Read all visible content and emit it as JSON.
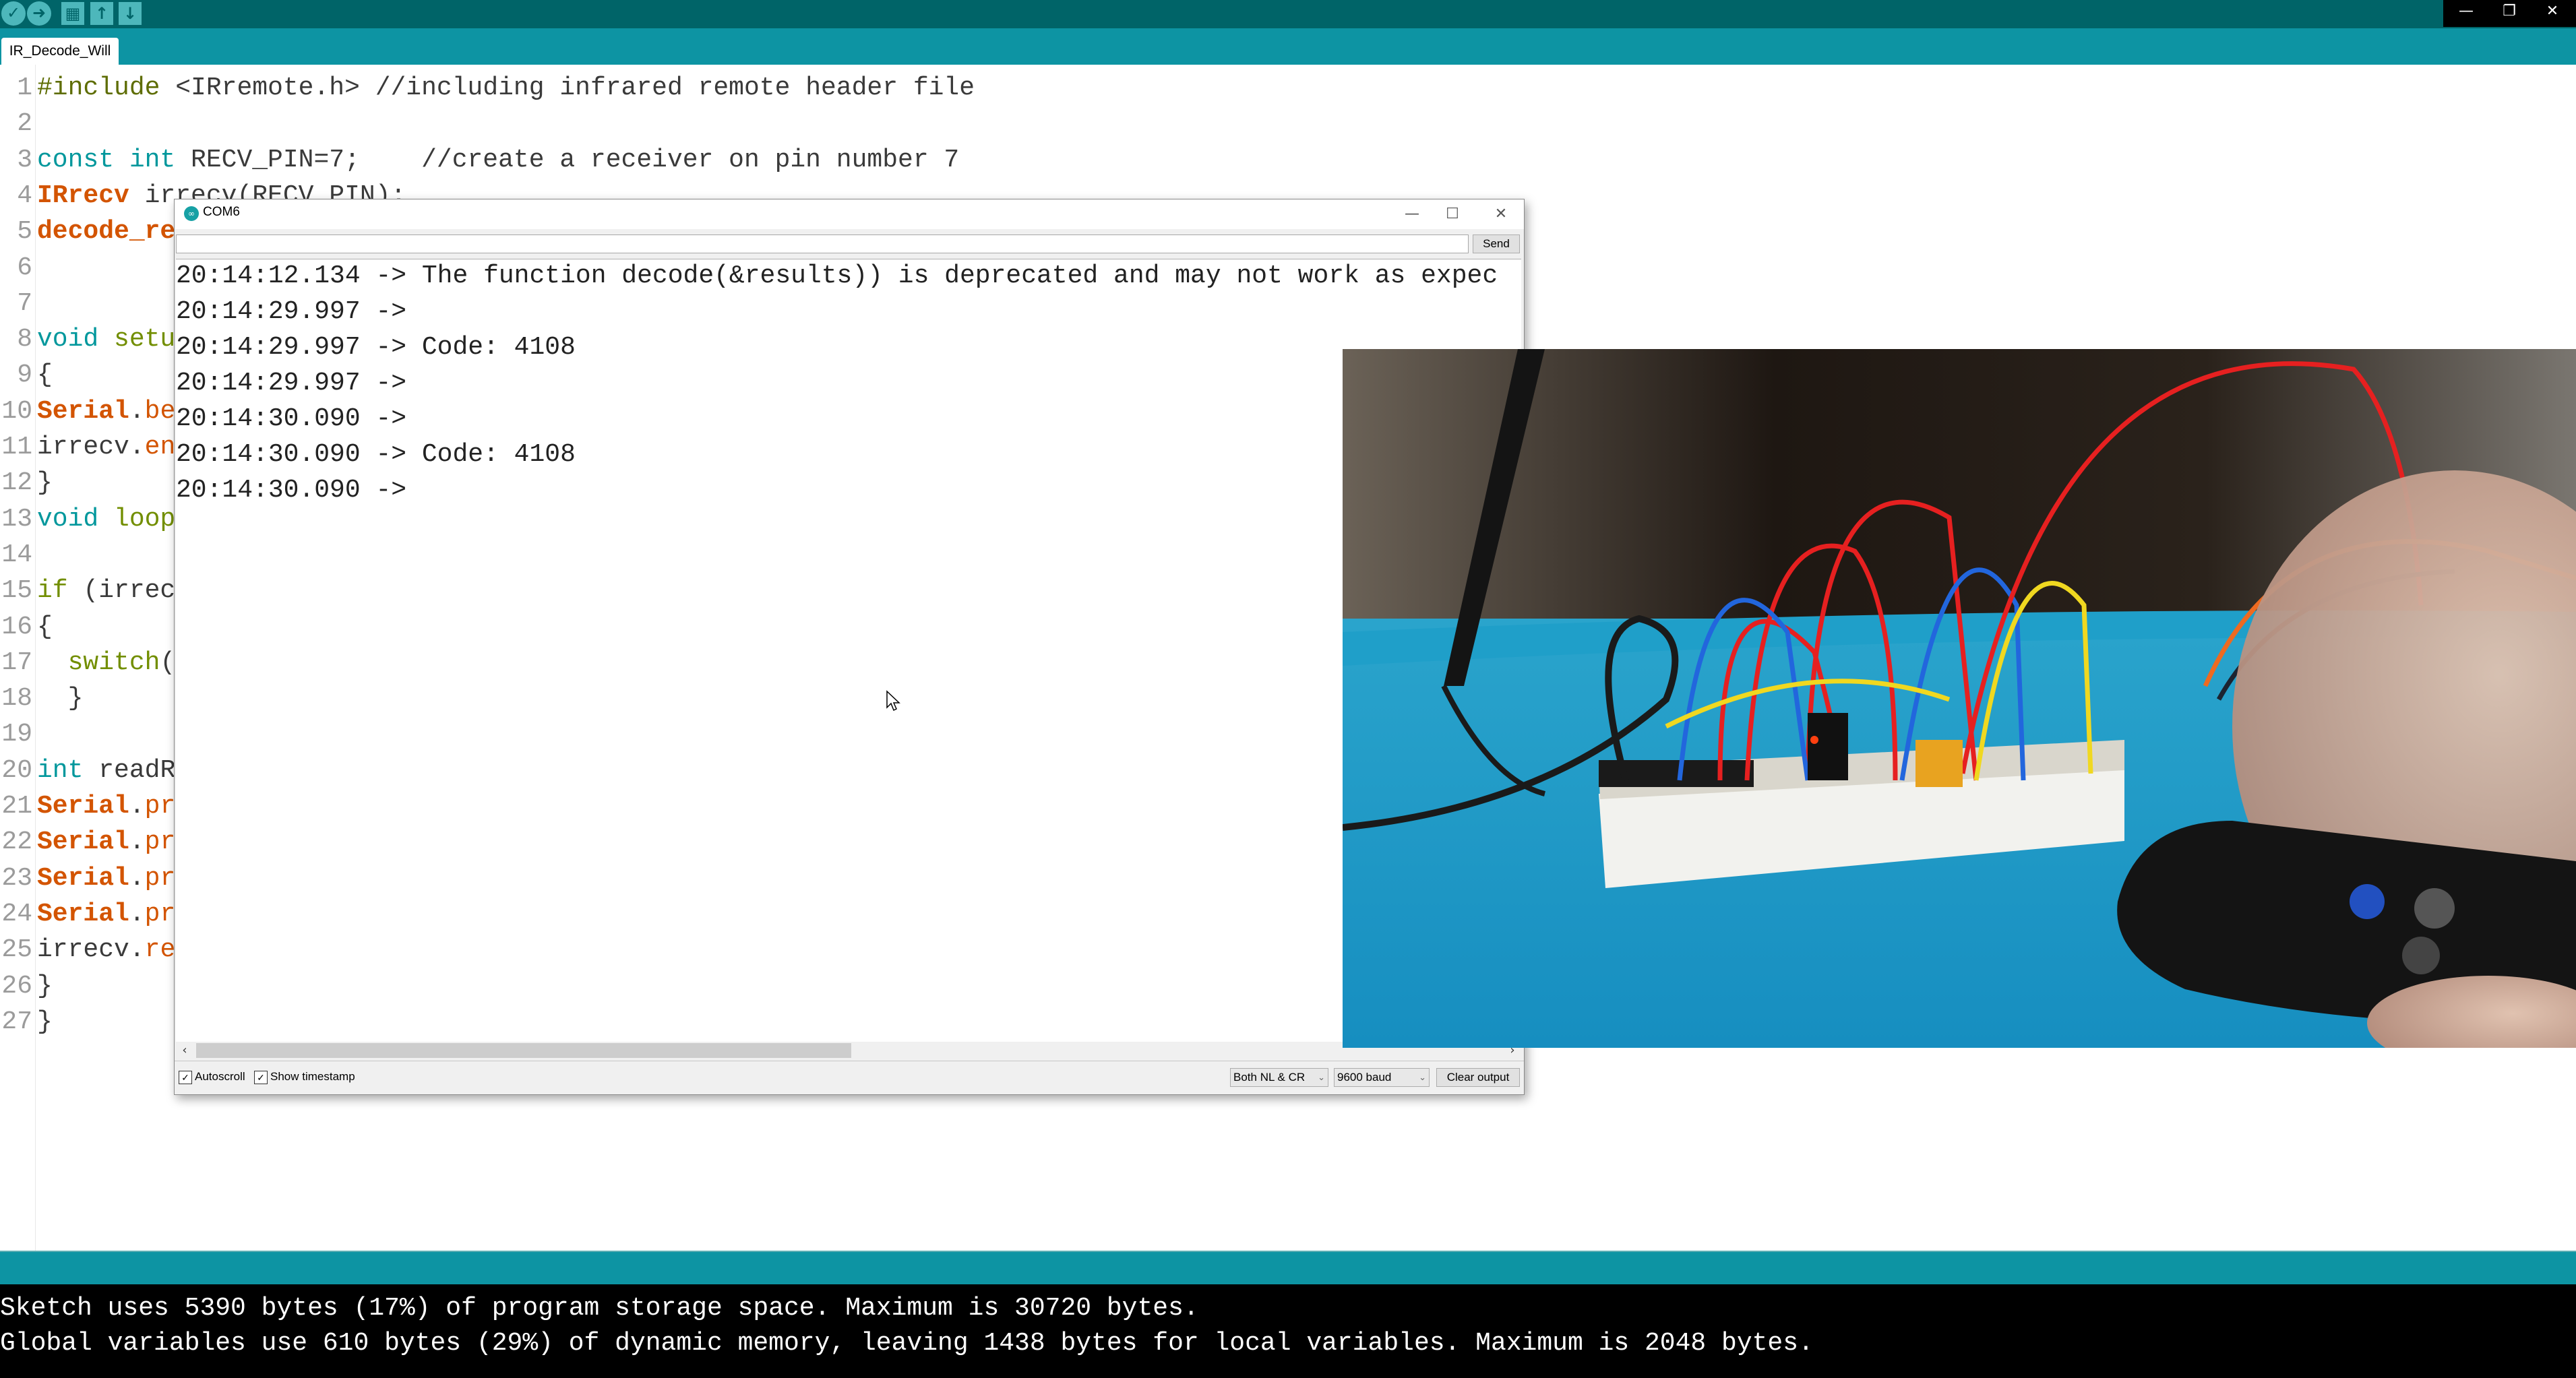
{
  "toolbar": {
    "buttons": [
      {
        "name": "verify",
        "icon": "check-icon",
        "glyph": "✓"
      },
      {
        "name": "upload",
        "icon": "arrow-right-icon",
        "glyph": "➜"
      },
      {
        "name": "new",
        "icon": "new-file-icon",
        "glyph": "▦"
      },
      {
        "name": "open",
        "icon": "arrow-up-icon",
        "glyph": "↑"
      },
      {
        "name": "save",
        "icon": "arrow-down-icon",
        "glyph": "↓"
      }
    ],
    "window_controls": {
      "minimize": "—",
      "restore": "❐",
      "close": "✕"
    }
  },
  "tabs": [
    {
      "label": "IR_Decode_Will",
      "active": true
    }
  ],
  "editor": {
    "lines": [
      {
        "n": "1",
        "segments": [
          {
            "t": "#include",
            "c": "pp"
          },
          {
            "t": " <IRremote.h> //including infrared remote header file",
            "c": ""
          }
        ]
      },
      {
        "n": "2",
        "segments": []
      },
      {
        "n": "3",
        "segments": [
          {
            "t": "const int",
            "c": "kw"
          },
          {
            "t": " RECV_PIN=7;    //create a receiver on pin number 7",
            "c": ""
          }
        ]
      },
      {
        "n": "4",
        "segments": [
          {
            "t": "IRrecv",
            "c": "ty"
          },
          {
            "t": " irrecv(RECV_PIN);",
            "c": ""
          }
        ]
      },
      {
        "n": "5",
        "segments": [
          {
            "t": "decode_re",
            "c": "ty"
          }
        ]
      },
      {
        "n": "6",
        "segments": []
      },
      {
        "n": "7",
        "segments": []
      },
      {
        "n": "8",
        "segments": [
          {
            "t": "void",
            "c": "kw"
          },
          {
            "t": " setu",
            "c": "ctl"
          }
        ]
      },
      {
        "n": "9",
        "segments": [
          {
            "t": "{",
            "c": ""
          }
        ]
      },
      {
        "n": "10",
        "segments": [
          {
            "t": "Serial",
            "c": "ty"
          },
          {
            "t": ".",
            "c": ""
          },
          {
            "t": "be",
            "c": "fn"
          }
        ]
      },
      {
        "n": "11",
        "segments": [
          {
            "t": "irrecv.",
            "c": ""
          },
          {
            "t": "en",
            "c": "fn"
          }
        ]
      },
      {
        "n": "12",
        "segments": [
          {
            "t": "}",
            "c": ""
          }
        ]
      },
      {
        "n": "13",
        "segments": [
          {
            "t": "void",
            "c": "kw"
          },
          {
            "t": " loop",
            "c": "ctl"
          }
        ]
      },
      {
        "n": "14",
        "segments": []
      },
      {
        "n": "15",
        "segments": [
          {
            "t": "if",
            "c": "ctl"
          },
          {
            "t": " (irrec",
            "c": ""
          }
        ]
      },
      {
        "n": "16",
        "segments": [
          {
            "t": "{",
            "c": ""
          }
        ]
      },
      {
        "n": "17",
        "segments": [
          {
            "t": "  switch",
            "c": "ctl"
          },
          {
            "t": "(",
            "c": ""
          }
        ]
      },
      {
        "n": "18",
        "segments": [
          {
            "t": "  }",
            "c": ""
          }
        ]
      },
      {
        "n": "19",
        "segments": []
      },
      {
        "n": "20",
        "segments": [
          {
            "t": "int",
            "c": "kw"
          },
          {
            "t": " readR",
            "c": ""
          }
        ]
      },
      {
        "n": "21",
        "segments": [
          {
            "t": "Serial",
            "c": "ty"
          },
          {
            "t": ".",
            "c": ""
          },
          {
            "t": "pr",
            "c": "fn"
          }
        ]
      },
      {
        "n": "22",
        "segments": [
          {
            "t": "Serial",
            "c": "ty"
          },
          {
            "t": ".",
            "c": ""
          },
          {
            "t": "pr",
            "c": "fn"
          }
        ]
      },
      {
        "n": "23",
        "segments": [
          {
            "t": "Serial",
            "c": "ty"
          },
          {
            "t": ".",
            "c": ""
          },
          {
            "t": "pr",
            "c": "fn"
          }
        ]
      },
      {
        "n": "24",
        "segments": [
          {
            "t": "Serial",
            "c": "ty"
          },
          {
            "t": ".",
            "c": ""
          },
          {
            "t": "pr",
            "c": "fn"
          }
        ]
      },
      {
        "n": "25",
        "segments": [
          {
            "t": "irrecv.",
            "c": ""
          },
          {
            "t": "re",
            "c": "fn"
          }
        ]
      },
      {
        "n": "26",
        "segments": [
          {
            "t": "}",
            "c": ""
          }
        ]
      },
      {
        "n": "27",
        "segments": [
          {
            "t": "}",
            "c": ""
          }
        ]
      }
    ]
  },
  "console": {
    "lines": [
      "Sketch uses 5390 bytes (17%) of program storage space. Maximum is 30720 bytes.",
      "Global variables use 610 bytes (29%) of dynamic memory, leaving 1438 bytes for local variables. Maximum is 2048 bytes."
    ]
  },
  "serial_monitor": {
    "title": "COM6",
    "logo_glyph": "∞",
    "input_value": "",
    "send_label": "Send",
    "output": [
      "20:14:12.134 -> The function decode(&results)) is deprecated and may not work as expec",
      "20:14:29.997 -> ",
      "20:14:29.997 -> Code: 4108",
      "20:14:29.997 -> ",
      "20:14:30.090 -> ",
      "20:14:30.090 -> Code: 4108",
      "20:14:30.090 -> "
    ],
    "autoscroll_label": "Autoscroll",
    "autoscroll_checked": true,
    "timestamp_label": "Show timestamp",
    "timestamp_checked": true,
    "line_ending": "Both NL & CR",
    "baud": "9600 baud",
    "clear_label": "Clear output",
    "scroll_left": "‹",
    "scroll_right": "›"
  },
  "video_overlay": {
    "description": "Photo of breadboard with Arduino Nano, IR receiver, jumper wires and hand holding IR remote"
  }
}
